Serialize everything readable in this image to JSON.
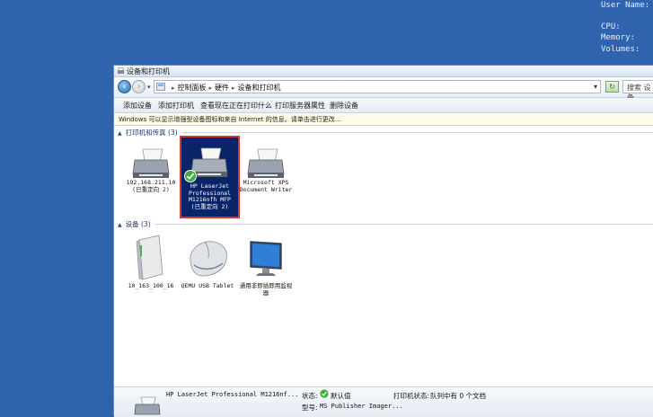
{
  "desktop": {
    "user_label": "User Name:",
    "cpu_label": "CPU:",
    "memory_label": "Memory:",
    "volumes_label": "Volumes:"
  },
  "window": {
    "title": "设备和打印机",
    "address": {
      "crumbs": [
        "控制面板",
        "硬件",
        "设备和打印机"
      ]
    },
    "search": {
      "placeholder": "搜索 设备..."
    },
    "commands": [
      "添加设备",
      "添加打印机",
      "查看现在正在打印什么",
      "打印服务器属性",
      "删除设备"
    ],
    "infobar": "Windows 可以显示增强型设备图标和来自 Internet 的信息。请单击进行更改...",
    "sections": {
      "printers": {
        "title": "打印机和传真 (3)",
        "items": [
          {
            "label": "192.168.211.10 (已重定向 2)"
          },
          {
            "label": "HP LaserJet Professional M1216nfh MFP (已重定向 2)"
          },
          {
            "label": "Microsoft XPS Document Writer"
          }
        ]
      },
      "devices": {
        "title": "设备 (3)",
        "items": [
          {
            "label": "10_163_100_16"
          },
          {
            "label": "QEMU USB Tablet"
          },
          {
            "label": "通用非即插即用监视器"
          }
        ]
      }
    },
    "details": {
      "name": "HP LaserJet Professional M1216nf...",
      "status_label": "状态:",
      "status_value": "默认值",
      "print_status_label": "打印机状态:",
      "print_status_value": "队列中有 0 个文档",
      "model_label": "型号:",
      "model_value": "MS Publisher Imager..."
    },
    "colors": {
      "desktop": "#2f63ad",
      "selection": "#0a246a",
      "selection_outline": "#d23a2a",
      "default_check": "#3fae3a"
    }
  }
}
